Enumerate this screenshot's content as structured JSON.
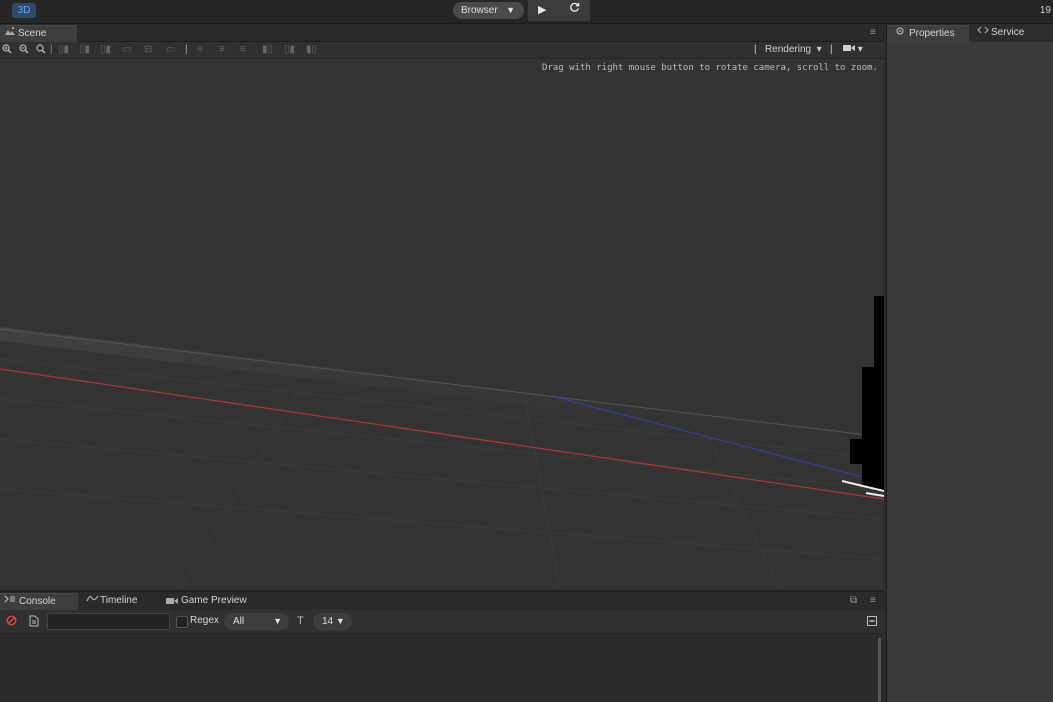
{
  "topbar": {
    "mode_badge": "3D",
    "browser_select": "Browser",
    "browser_caret": "▼",
    "play_icon": "▶",
    "refresh_icon": "C",
    "clock": "19"
  },
  "scene_panel": {
    "tab_label": "Scene",
    "menu_icon": "≡",
    "toolbar": {
      "rendering_label": "Rendering",
      "rendering_caret": "▾",
      "separator": "|",
      "camera_caret": "▾"
    },
    "hint": "Drag with right mouse button to rotate camera, scroll to zoom."
  },
  "right_panel": {
    "tabs": [
      {
        "label": "Properties",
        "icon": "gear-icon"
      },
      {
        "label": "Service",
        "icon": "code-icon"
      }
    ]
  },
  "bottom_panel": {
    "tabs": [
      {
        "label": "Console",
        "icon": "terminal-icon"
      },
      {
        "label": "Timeline",
        "icon": "timeline-icon"
      },
      {
        "label": "Game Preview",
        "icon": "camera-icon"
      }
    ],
    "search_value": "",
    "regex_label": "Regex",
    "filter_select": "All",
    "filter_caret": "▼",
    "font_size_value": "14",
    "font_size_caret": "▼"
  },
  "colors": {
    "accent_blue": "#5aa9ff",
    "x_axis": "#b03a3a",
    "z_axis": "#3b3b9c",
    "panel_bg": "#3a3a3a",
    "viewport_bg": "#333333"
  }
}
